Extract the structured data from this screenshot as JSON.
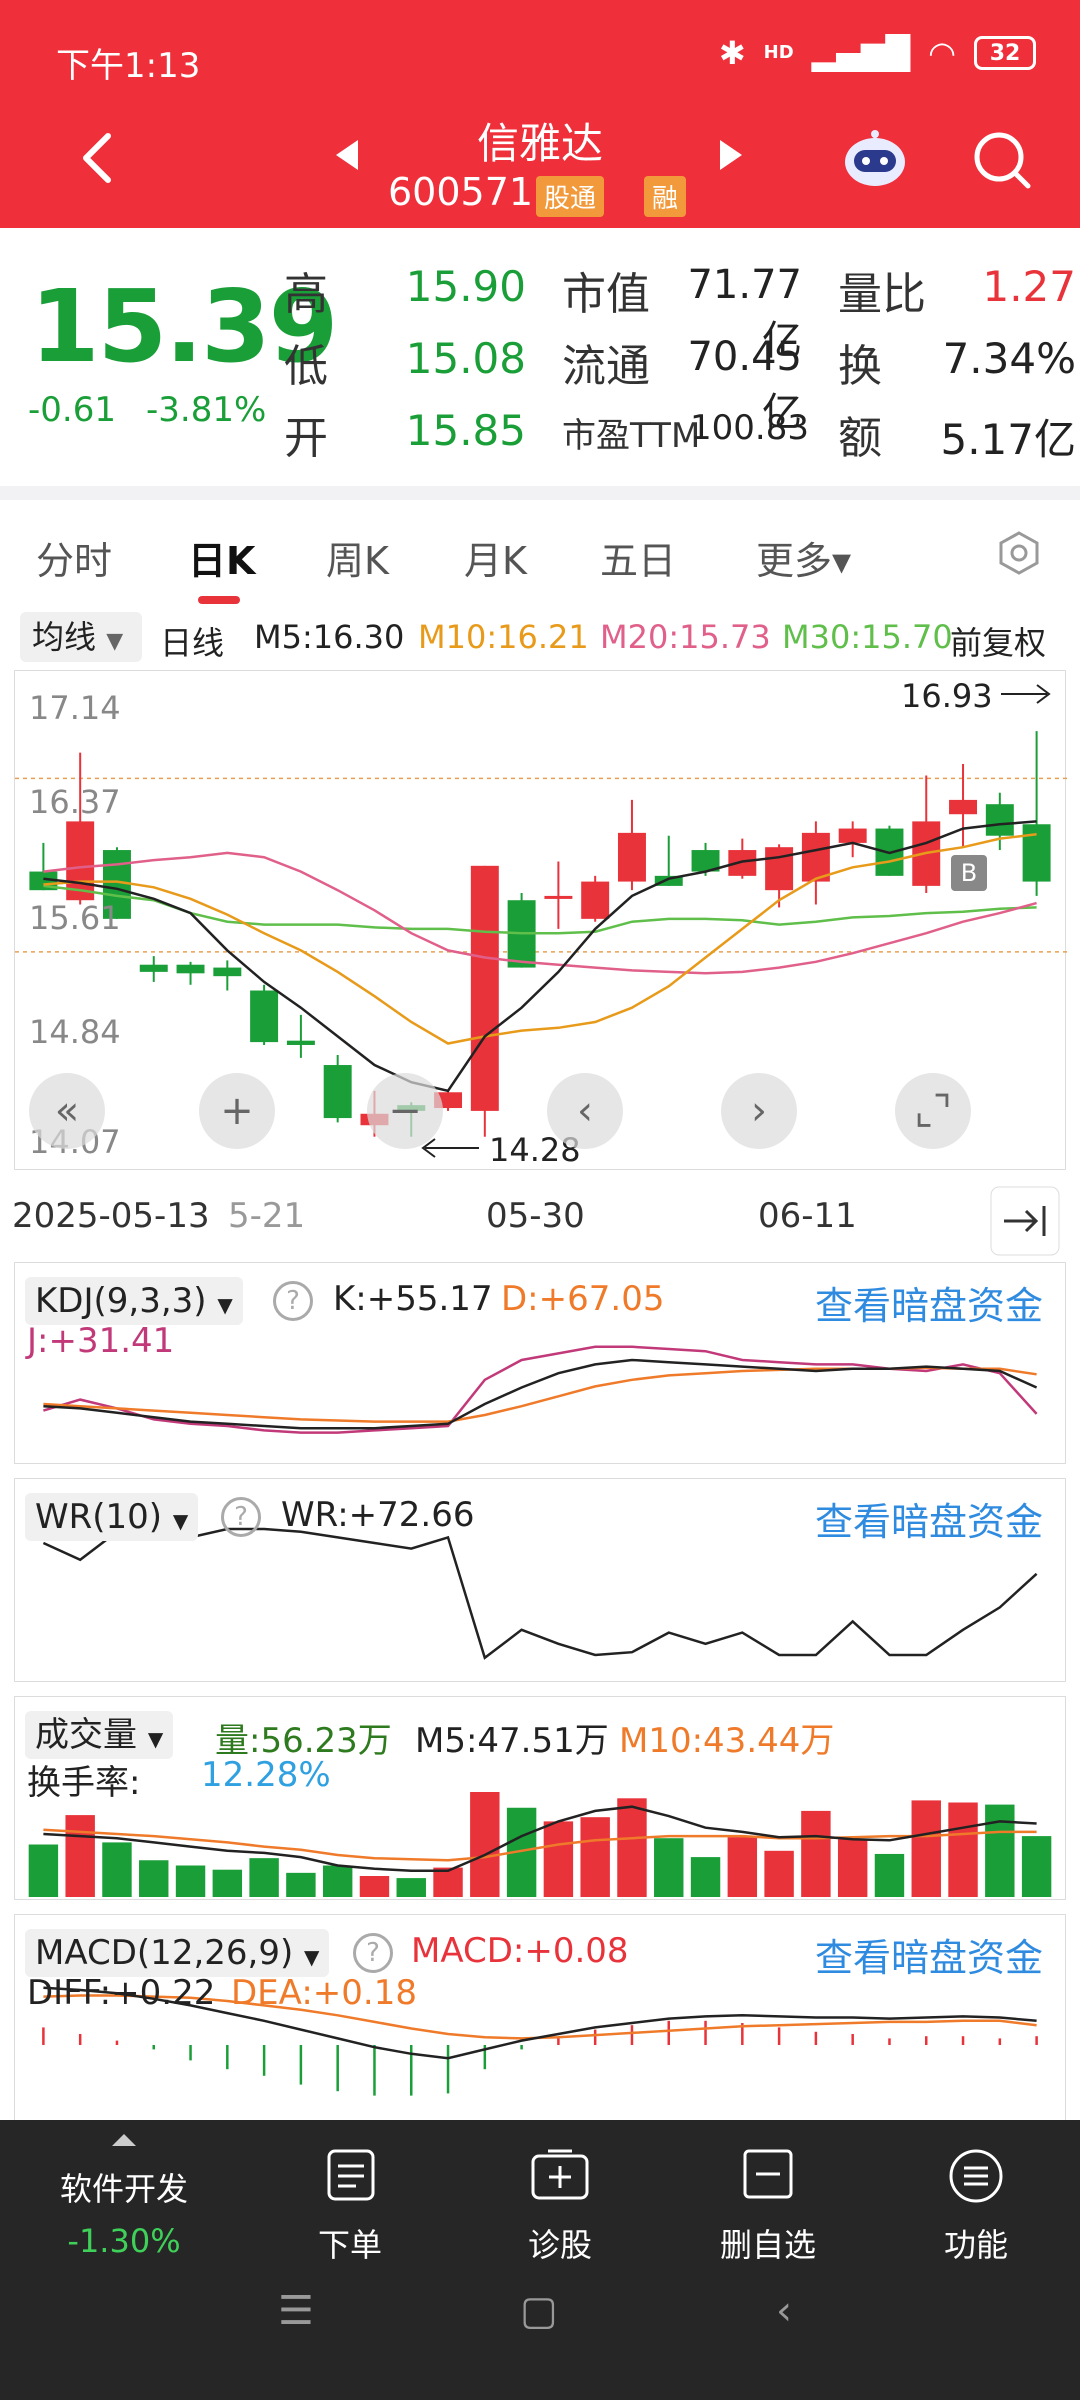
{
  "status": {
    "time": "下午1:13",
    "battery": "32",
    "hd": "HD"
  },
  "header": {
    "stock_name": "信雅达",
    "stock_code": "600571",
    "badge_tong": "股通",
    "badge_rong": "融"
  },
  "quote": {
    "price": "15.39",
    "change": "-0.61",
    "change_pct": "-3.81%",
    "high_label": "高",
    "high": "15.90",
    "low_label": "低",
    "low": "15.08",
    "open_label": "开",
    "open": "15.85",
    "mcap_label": "市值",
    "mcap": "71.77亿",
    "float_label": "流通",
    "float": "70.45亿",
    "pe_label": "市盈TTM",
    "pe": "100.83",
    "vr_label": "量比",
    "vr": "1.27",
    "turn_label": "换",
    "turn": "7.34%",
    "amt_label": "额",
    "amt": "5.17亿"
  },
  "tabs": [
    "分时",
    "日K",
    "周K",
    "月K",
    "五日",
    "更多▾"
  ],
  "ma": {
    "select": "均线",
    "period": "日线",
    "m5": "M5:16.30",
    "m10": "M10:16.21",
    "m20": "M20:15.73",
    "m30": "M30:15.70",
    "adj": "前复权",
    "colors": {
      "m5": "#222222",
      "m10": "#e89a1a",
      "m20": "#e0608a",
      "m30": "#5fbf4a"
    }
  },
  "kline": {
    "y_labels": [
      "17.14",
      "16.37",
      "15.61",
      "14.84",
      "14.07"
    ],
    "max_label": "16.93",
    "min_label": "14.28",
    "x_labels": [
      "2025-05-13",
      "5-21",
      "05-30",
      "06-11"
    ],
    "marker_b": "B"
  },
  "kdj": {
    "select": "KDJ(9,3,3)",
    "k": "K:+55.17",
    "d": "D:+67.05",
    "j": "J:+31.41",
    "link": "查看暗盘资金"
  },
  "wr": {
    "select": "WR(10)",
    "wr": "WR:+72.66",
    "link": "查看暗盘资金"
  },
  "vol": {
    "select": "成交量",
    "vol": "量:56.23万",
    "m5": "M5:47.51万",
    "m10": "M10:43.44万",
    "turn_label": "换手率:",
    "turn": "12.28%"
  },
  "macd": {
    "select": "MACD(12,26,9)",
    "macd": "MACD:+0.08",
    "diff": "DIFF:+0.22",
    "dea": "DEA:+0.18",
    "link": "查看暗盘资金"
  },
  "bottom": {
    "index_name": "软件开发",
    "index_chg": "-1.30%",
    "items": [
      "下单",
      "诊股",
      "删自选",
      "功能"
    ]
  },
  "chart_data": {
    "type": "candlestick",
    "ylim": [
      14.07,
      17.14
    ],
    "candles": [
      {
        "o": 15.95,
        "h": 16.15,
        "l": 15.82,
        "c": 15.82
      },
      {
        "o": 15.75,
        "h": 16.78,
        "l": 15.72,
        "c": 16.3
      },
      {
        "o": 16.1,
        "h": 16.12,
        "l": 15.62,
        "c": 15.62
      },
      {
        "o": 15.3,
        "h": 15.36,
        "l": 15.18,
        "c": 15.25
      },
      {
        "o": 15.3,
        "h": 15.32,
        "l": 15.16,
        "c": 15.24
      },
      {
        "o": 15.28,
        "h": 15.33,
        "l": 15.12,
        "c": 15.22
      },
      {
        "o": 15.12,
        "h": 15.16,
        "l": 14.74,
        "c": 14.76
      },
      {
        "o": 14.77,
        "h": 14.95,
        "l": 14.65,
        "c": 14.74
      },
      {
        "o": 14.6,
        "h": 14.67,
        "l": 14.2,
        "c": 14.23
      },
      {
        "o": 14.18,
        "h": 14.42,
        "l": 14.1,
        "c": 14.26
      },
      {
        "o": 14.32,
        "h": 14.34,
        "l": 14.1,
        "c": 14.28
      },
      {
        "o": 14.3,
        "h": 14.43,
        "l": 14.28,
        "c": 14.41
      },
      {
        "o": 14.28,
        "h": 15.99,
        "l": 14.1,
        "c": 15.99
      },
      {
        "o": 15.75,
        "h": 15.8,
        "l": 15.28,
        "c": 15.28
      },
      {
        "o": 15.78,
        "h": 16.02,
        "l": 15.55,
        "c": 15.78
      },
      {
        "o": 15.62,
        "h": 15.92,
        "l": 15.6,
        "c": 15.88
      },
      {
        "o": 15.88,
        "h": 16.45,
        "l": 15.82,
        "c": 16.22
      },
      {
        "o": 15.92,
        "h": 16.2,
        "l": 15.85,
        "c": 15.85
      },
      {
        "o": 16.1,
        "h": 16.15,
        "l": 15.92,
        "c": 15.95
      },
      {
        "o": 15.92,
        "h": 16.18,
        "l": 15.9,
        "c": 16.1
      },
      {
        "o": 15.82,
        "h": 16.14,
        "l": 15.7,
        "c": 16.12
      },
      {
        "o": 15.88,
        "h": 16.3,
        "l": 15.72,
        "c": 16.22
      },
      {
        "o": 16.15,
        "h": 16.3,
        "l": 16.05,
        "c": 16.25
      },
      {
        "o": 16.25,
        "h": 16.27,
        "l": 15.92,
        "c": 15.92
      },
      {
        "o": 15.85,
        "h": 16.62,
        "l": 15.8,
        "c": 16.3
      },
      {
        "o": 16.35,
        "h": 16.7,
        "l": 16.12,
        "c": 16.45
      },
      {
        "o": 16.42,
        "h": 16.5,
        "l": 16.1,
        "c": 16.2
      },
      {
        "o": 16.28,
        "h": 16.93,
        "l": 15.78,
        "c": 15.88
      }
    ],
    "ma5": [
      15.9,
      15.87,
      15.83,
      15.76,
      15.66,
      15.4,
      15.18,
      15.0,
      14.8,
      14.6,
      14.48,
      14.42,
      14.8,
      15.0,
      15.25,
      15.55,
      15.78,
      15.9,
      15.95,
      16.02,
      16.05,
      16.1,
      16.15,
      16.08,
      16.15,
      16.25,
      16.28,
      16.3
    ],
    "ma10": [
      15.86,
      15.88,
      15.88,
      15.84,
      15.76,
      15.65,
      15.52,
      15.4,
      15.25,
      15.08,
      14.9,
      14.75,
      14.8,
      14.84,
      14.86,
      14.9,
      15.0,
      15.15,
      15.35,
      15.55,
      15.75,
      15.9,
      15.98,
      16.02,
      16.08,
      16.12,
      16.18,
      16.21
    ],
    "ma20": [
      15.95,
      15.98,
      16.0,
      16.03,
      16.05,
      16.08,
      16.05,
      15.95,
      15.82,
      15.68,
      15.52,
      15.4,
      15.35,
      15.32,
      15.3,
      15.28,
      15.26,
      15.25,
      15.24,
      15.25,
      15.28,
      15.32,
      15.38,
      15.45,
      15.52,
      15.6,
      15.66,
      15.73
    ],
    "ma30": [
      15.85,
      15.82,
      15.78,
      15.75,
      15.66,
      15.6,
      15.58,
      15.58,
      15.58,
      15.56,
      15.55,
      15.55,
      15.53,
      15.52,
      15.52,
      15.53,
      15.6,
      15.62,
      15.62,
      15.61,
      15.58,
      15.6,
      15.63,
      15.64,
      15.66,
      15.67,
      15.69,
      15.7
    ],
    "volume": [
      50,
      78,
      52,
      35,
      30,
      26,
      37,
      23,
      30,
      20,
      18,
      28,
      100,
      85,
      72,
      76,
      94,
      56,
      38,
      57,
      44,
      82,
      55,
      41,
      92,
      90,
      88,
      58
    ],
    "vol_ma5": [
      60,
      58,
      56,
      52,
      48,
      44,
      42,
      38,
      30,
      27,
      25,
      25,
      40,
      58,
      72,
      82,
      86,
      77,
      66,
      62,
      57,
      58,
      55,
      54,
      60,
      66,
      72,
      70
    ],
    "vol_ma10": [
      64,
      62,
      60,
      58,
      55,
      52,
      48,
      45,
      40,
      37,
      36,
      35,
      38,
      44,
      50,
      54,
      56,
      58,
      58,
      58,
      56,
      56,
      57,
      58,
      58,
      60,
      62,
      62
    ],
    "kdj_k": [
      38,
      36,
      32,
      28,
      24,
      22,
      20,
      18,
      18,
      18,
      20,
      22,
      40,
      55,
      68,
      76,
      80,
      78,
      76,
      74,
      72,
      70,
      72,
      72,
      74,
      72,
      70,
      55
    ],
    "kdj_d": [
      40,
      38,
      36,
      34,
      32,
      30,
      28,
      26,
      25,
      24,
      24,
      24,
      30,
      38,
      47,
      56,
      62,
      66,
      68,
      70,
      71,
      72,
      72,
      72,
      73,
      72,
      72,
      67
    ],
    "kdj_j": [
      34,
      44,
      36,
      26,
      22,
      20,
      16,
      14,
      14,
      16,
      18,
      20,
      62,
      80,
      86,
      92,
      92,
      90,
      88,
      80,
      78,
      76,
      76,
      72,
      70,
      76,
      68,
      31
    ],
    "wr": [
      10,
      22,
      2,
      2,
      6,
      0,
      0,
      2,
      6,
      10,
      14,
      6,
      92,
      72,
      82,
      90,
      88,
      74,
      82,
      74,
      90,
      90,
      66,
      90,
      90,
      72,
      56,
      32
    ],
    "macd_diff": [
      0.52,
      0.5,
      0.47,
      0.42,
      0.36,
      0.29,
      0.22,
      0.14,
      0.06,
      -0.02,
      -0.08,
      -0.12,
      -0.04,
      0.04,
      0.1,
      0.16,
      0.2,
      0.24,
      0.26,
      0.27,
      0.26,
      0.25,
      0.25,
      0.24,
      0.25,
      0.26,
      0.25,
      0.22
    ],
    "macd_dea": [
      0.44,
      0.45,
      0.45,
      0.44,
      0.43,
      0.4,
      0.36,
      0.32,
      0.27,
      0.21,
      0.15,
      0.1,
      0.07,
      0.06,
      0.07,
      0.09,
      0.11,
      0.13,
      0.15,
      0.17,
      0.18,
      0.19,
      0.2,
      0.21,
      0.21,
      0.22,
      0.22,
      0.18
    ],
    "macd_hist": [
      0.16,
      0.1,
      0.04,
      -0.04,
      -0.14,
      -0.22,
      -0.28,
      -0.36,
      -0.42,
      -0.46,
      -0.46,
      -0.44,
      -0.22,
      -0.04,
      0.06,
      0.14,
      0.18,
      0.22,
      0.22,
      0.2,
      0.16,
      0.12,
      0.1,
      0.06,
      0.08,
      0.08,
      0.06,
      0.08
    ]
  }
}
